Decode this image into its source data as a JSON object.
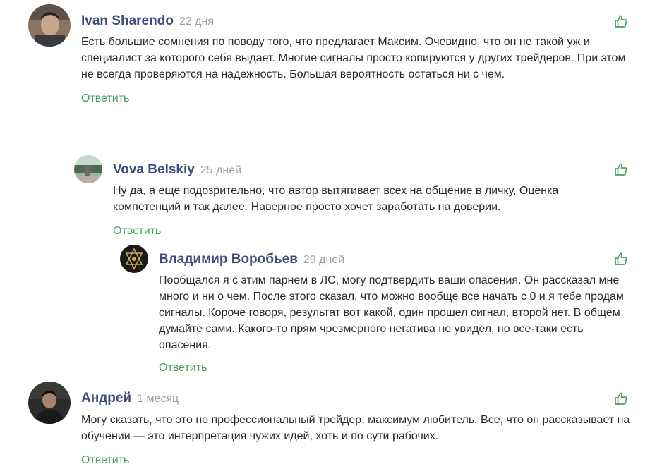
{
  "comments": [
    {
      "author": "Ivan Sharendo",
      "time": "22 дня",
      "text": "Есть большие сомнения по поводу того, что предлагает Максим. Очевидно, что он не такой уж и специалист за которого себя выдает. Многие сигналы просто копируются у других трейдеров. При этом не всегда проверяются на надежность. Большая вероятность остаться ни с чем.",
      "reply_label": "Ответить"
    },
    {
      "author": "Vova Belskiy",
      "time": "25 дней",
      "text": "Ну да, а еще подозрительно, что автор вытягивает всех на общение в личку, Оценка компетенций и так далее. Наверное просто хочет заработать на доверии.",
      "reply_label": "Ответить"
    },
    {
      "author": "Владимир Воробьев",
      "time": "29 дней",
      "text": "Пообщался я с этим парнем в ЛС, могу подтвердить ваши опасения. Он рассказал мне много и ни о чем. После этого сказал, что можно вообще все начать с 0 и я тебе продам сигналы. Короче говоря, результат вот какой, один прошел сигнал, второй нет. В общем думайте сами. Какого-то прям чрезмерного негатива не увидел, но все-таки есть опасения.",
      "reply_label": "Ответить"
    },
    {
      "author": "Андрей",
      "time": "1 месяц",
      "text": "Могу сказать, что это не профессиональный трейдер, максимум любитель. Все, что он рассказывает на обучении — это интерпретация чужих идей, хоть и по сути рабочих.",
      "reply_label": "Ответить"
    }
  ],
  "colors": {
    "author": "#3d4e7d",
    "time": "#9a9fa8",
    "reply": "#47a05a",
    "like_icon": "#47a05a",
    "text": "#2b2b2b",
    "divider": "#e4e6ea"
  },
  "icons": {
    "like": "thumbs-up-icon"
  }
}
